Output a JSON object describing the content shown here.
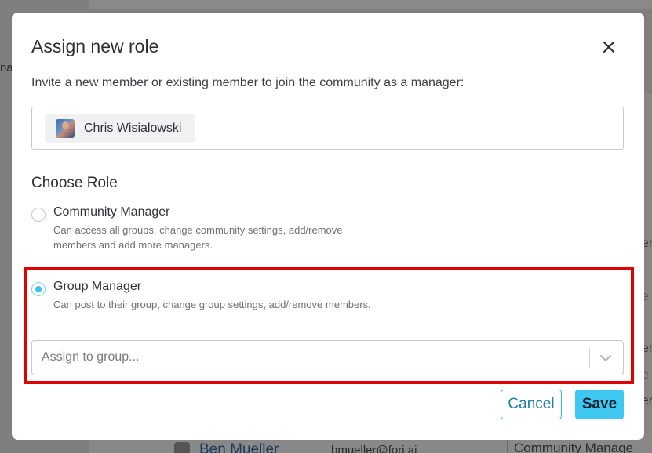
{
  "background": {
    "left_fragment": "na",
    "right_fragments": [
      "er",
      "e",
      "er",
      "e",
      "er"
    ],
    "row": {
      "name": "Ben Mueller",
      "email": "bmueller@fori.ai",
      "role": "Community Manage"
    }
  },
  "modal": {
    "title": "Assign new role",
    "close_icon": "close-icon",
    "description": "Invite a new member or existing member to join the community as a manager:",
    "member_chip": {
      "name": "Chris Wisialowski",
      "avatar": "avatar-photo"
    },
    "choose_role_label": "Choose Role",
    "roles": [
      {
        "name": "Community Manager",
        "description": "Can access all groups, change community settings, add/remove members and add more managers.",
        "selected": false
      },
      {
        "name": "Group Manager",
        "description": "Can post to their group, change group settings, add/remove members.",
        "selected": true
      }
    ],
    "group_select": {
      "placeholder": "Assign to group...",
      "icon": "chevron-down-icon"
    },
    "cancel_label": "Cancel",
    "save_label": "Save"
  },
  "colors": {
    "accent": "#3ec8f1",
    "accent_border": "#33b9e6",
    "highlight": "#e10000",
    "overlay": "#7f7f7f"
  }
}
